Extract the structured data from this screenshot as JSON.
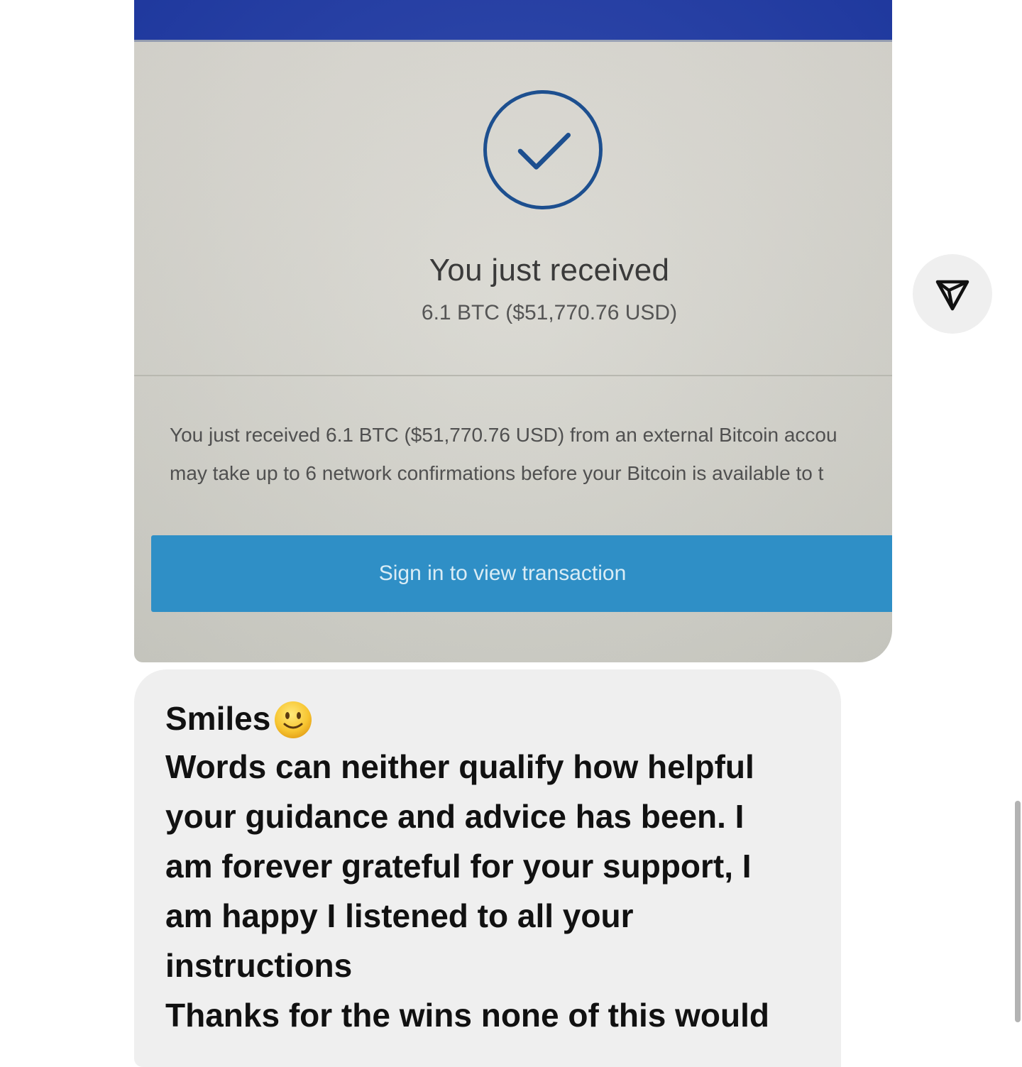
{
  "image_message": {
    "check_icon": "checkmark-circle-icon",
    "title": "You just received",
    "amount": "6.1 BTC ($51,770.76 USD)",
    "body_lines": [
      "You just received 6.1 BTC ($51,770.76 USD) from an external Bitcoin accou",
      "may take up to 6 network confirmations before your Bitcoin is available to t"
    ],
    "button_label": "Sign in to view transaction",
    "colors": {
      "topbar": "#1f3aa6",
      "check": "#1d4f8f",
      "button": "#2f8fc6"
    }
  },
  "share_button": {
    "icon": "send-icon"
  },
  "text_message": {
    "first_line": "Smiles",
    "emoji": "slightly-smiling-face-emoji",
    "lines": [
      "Words can neither qualify how helpful",
      "your guidance and advice has been. I",
      "am forever grateful for your support, I",
      "am happy I listened to all your",
      "instructions",
      "Thanks for the wins none of this would"
    ]
  }
}
